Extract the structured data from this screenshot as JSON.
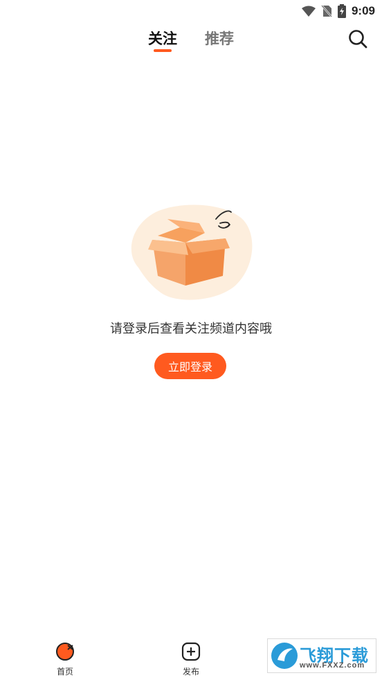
{
  "status_bar": {
    "time": "9:09",
    "icons": [
      "wifi-icon",
      "no-sim-icon",
      "battery-charging-icon"
    ]
  },
  "header": {
    "tabs": [
      {
        "label": "关注",
        "active": true
      },
      {
        "label": "推荐",
        "active": false
      }
    ],
    "search_icon": "search-icon",
    "accent_color": "#ff5a1f"
  },
  "empty_state": {
    "illustration": "empty-box-icon",
    "message": "请登录后查看关注频道内容哦",
    "login_button": "立即登录"
  },
  "bottom_nav": {
    "items": [
      {
        "label": "首页",
        "icon": "home-logo-icon"
      },
      {
        "label": "发布",
        "icon": "plus-square-icon"
      }
    ]
  },
  "watermark": {
    "title": "飞翔下载",
    "url": "www.FXXZ.com"
  }
}
